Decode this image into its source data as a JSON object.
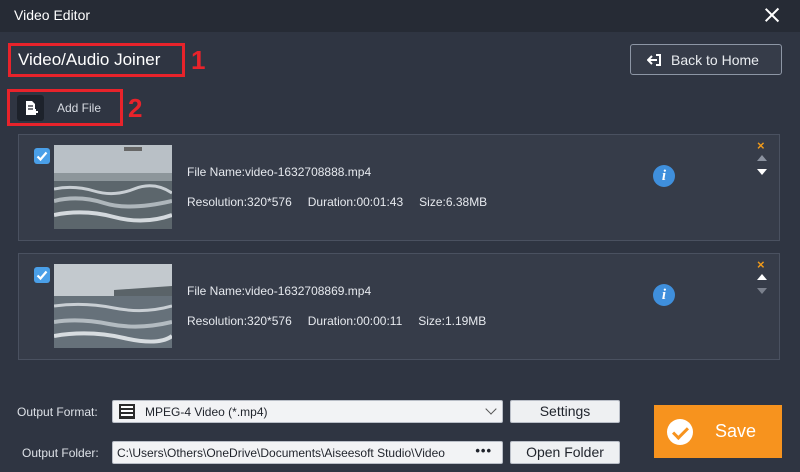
{
  "window": {
    "title": "Video Editor"
  },
  "module": {
    "title": "Video/Audio Joiner"
  },
  "annotations": {
    "one": "1",
    "two": "2"
  },
  "toolbar": {
    "back_label": "Back to Home",
    "add_file_label": "Add File"
  },
  "files": [
    {
      "checked": true,
      "name": "File Name:video-1632708888.mp4",
      "resolution": "Resolution:320*576",
      "duration": "Duration:00:01:43",
      "size": "Size:6.38MB"
    },
    {
      "checked": true,
      "name": "File Name:video-1632708869.mp4",
      "resolution": "Resolution:320*576",
      "duration": "Duration:00:00:11",
      "size": "Size:1.19MB"
    }
  ],
  "output": {
    "format_label": "Output Format:",
    "format_value": "MPEG-4 Video (*.mp4)",
    "settings_label": "Settings",
    "folder_label": "Output Folder:",
    "folder_value": "C:\\Users\\Others\\OneDrive\\Documents\\Aiseesoft Studio\\Video",
    "folder_more": "•••",
    "open_folder_label": "Open Folder",
    "save_label": "Save"
  },
  "icons": {
    "remove": "×",
    "info": "i"
  },
  "colors": {
    "accent_orange": "#f7931e",
    "annotation_red": "#e8232b",
    "info_blue": "#3f8fdc",
    "checkbox_blue": "#4a9fe8"
  }
}
